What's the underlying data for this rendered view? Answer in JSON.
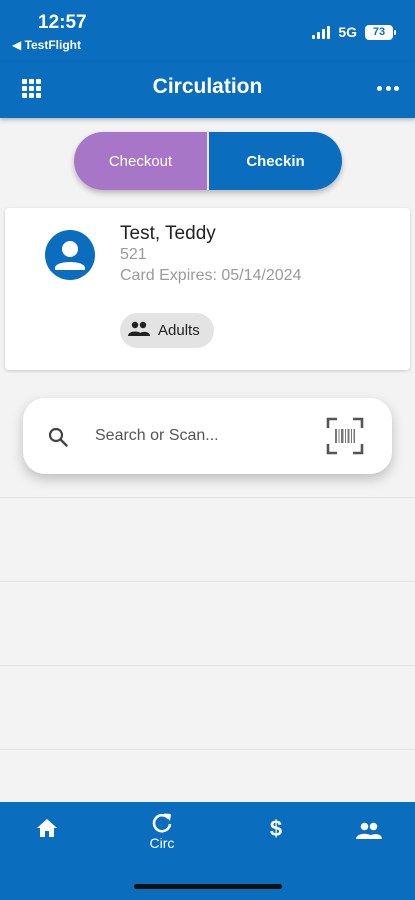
{
  "status_bar": {
    "time": "12:57",
    "back_app": "◀ TestFlight",
    "network": "5G",
    "battery": "73"
  },
  "app_bar": {
    "title": "Circulation",
    "left_icon": "grid-icon",
    "right_icon": "more-horizontal-icon"
  },
  "mode_toggle": {
    "checkout_label": "Checkout",
    "checkin_label": "Checkin",
    "selected": "Checkin"
  },
  "patron": {
    "name": "Test, Teddy",
    "id": "521",
    "card_expires": "Card Expires: 05/14/2024",
    "type_chip": "Adults",
    "avatar_icon": "person-icon"
  },
  "search": {
    "placeholder": "Search or Scan...",
    "value": "",
    "scan_icon": "barcode-scan-icon"
  },
  "list_rows": [
    {},
    {},
    {},
    {}
  ],
  "bottom_nav": {
    "items": [
      {
        "icon": "home-icon",
        "label": ""
      },
      {
        "icon": "refresh-icon",
        "label": "Circ"
      },
      {
        "icon": "dollar-icon",
        "label": "$"
      },
      {
        "icon": "people-icon",
        "label": ""
      }
    ]
  },
  "colors": {
    "primary": "#0a6dbd",
    "checkout": "#a876c6",
    "background": "#f3f3f3"
  }
}
